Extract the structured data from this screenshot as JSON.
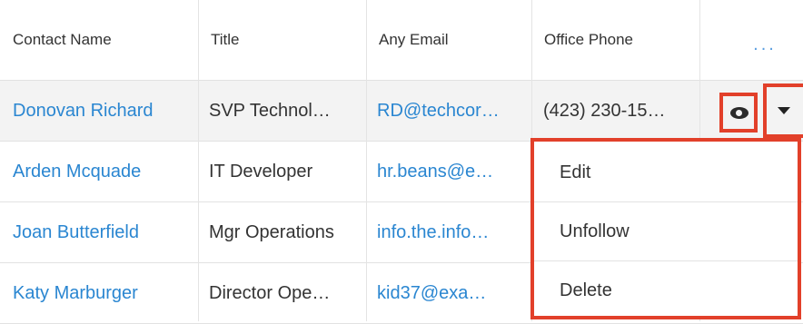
{
  "table": {
    "headers": [
      "Contact Name",
      "Title",
      "Any Email",
      "Office Phone"
    ],
    "more_label": "...",
    "rows": [
      {
        "name": "Donovan Richard",
        "title": "SVP Technol…",
        "email": "RD@techcor…",
        "phone": "(423) 230-15…"
      },
      {
        "name": "Arden Mcquade",
        "title": "IT Developer",
        "email": "hr.beans@e…",
        "phone": ""
      },
      {
        "name": "Joan Butterfield",
        "title": "Mgr Operations",
        "email": "info.the.info…",
        "phone": ""
      },
      {
        "name": "Katy Marburger",
        "title": "Director Ope…",
        "email": "kid37@exa…",
        "phone": ""
      }
    ]
  },
  "actions": {
    "preview_icon": "eye-icon",
    "dropdown_icon": "caret-down-icon"
  },
  "menu": {
    "items": [
      "Edit",
      "Unfollow",
      "Delete"
    ]
  },
  "colors": {
    "link": "#2a86d1",
    "highlight": "#e2402a",
    "row_hover": "#f3f3f3"
  }
}
